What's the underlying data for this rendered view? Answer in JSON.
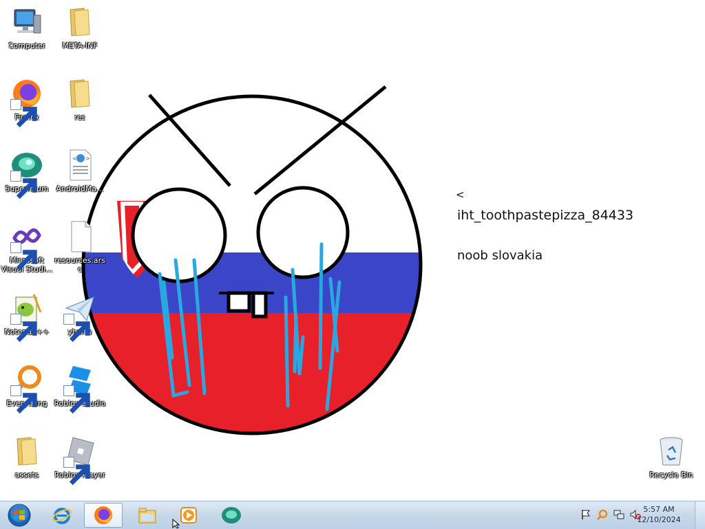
{
  "desktop": {
    "icons": [
      {
        "label": "Computer",
        "icon": "computer-icon"
      },
      {
        "label": "META-INF",
        "icon": "folder-icon"
      },
      {
        "label": "Firefox",
        "icon": "firefox-icon"
      },
      {
        "label": "res",
        "icon": "folder-icon"
      },
      {
        "label": "Supermium",
        "icon": "supermium-icon"
      },
      {
        "label": "AndroidMa...",
        "icon": "xml-file-icon"
      },
      {
        "label": "Microsoft Visual Studi...",
        "icon": "visual-studio-icon"
      },
      {
        "label": "resources.arsc",
        "icon": "blank-file-icon"
      },
      {
        "label": "Notepad++",
        "icon": "notepadpp-icon"
      },
      {
        "label": "yhsnw",
        "icon": "paper-plane-icon"
      },
      {
        "label": "Everything",
        "icon": "everything-search-icon"
      },
      {
        "label": "Roblox Studio",
        "icon": "roblox-studio-icon"
      },
      {
        "label": "assets",
        "icon": "folder-icon"
      },
      {
        "label": "Roblox Player",
        "icon": "roblox-player-icon"
      },
      {
        "label": "Recycle Bin",
        "icon": "recycle-bin-icon"
      }
    ]
  },
  "wallpaper": {
    "caret": "<",
    "username": "iht_toothpastepizza_84433",
    "caption": "noob slovakia"
  },
  "taskbar": {
    "buttons": [
      {
        "name": "start-button",
        "icon": "windows-orb-icon"
      },
      {
        "name": "internet-explorer",
        "icon": "internet-explorer-icon"
      },
      {
        "name": "firefox",
        "icon": "firefox-icon",
        "active": true
      },
      {
        "name": "file-explorer",
        "icon": "folder-icon"
      },
      {
        "name": "media-player",
        "icon": "media-player-icon"
      },
      {
        "name": "supermium",
        "icon": "supermium-icon"
      }
    ],
    "tray": [
      "flag-icon",
      "search-tray-icon",
      "network-icon",
      "volume-muted-icon"
    ],
    "clock": {
      "time": "5:57 AM",
      "date": "12/10/2024"
    }
  },
  "colors": {
    "slovak_white": "#ffffff",
    "slovak_blue": "#3a45c8",
    "slovak_red": "#e8202a",
    "tears": "#2aa7e0"
  }
}
